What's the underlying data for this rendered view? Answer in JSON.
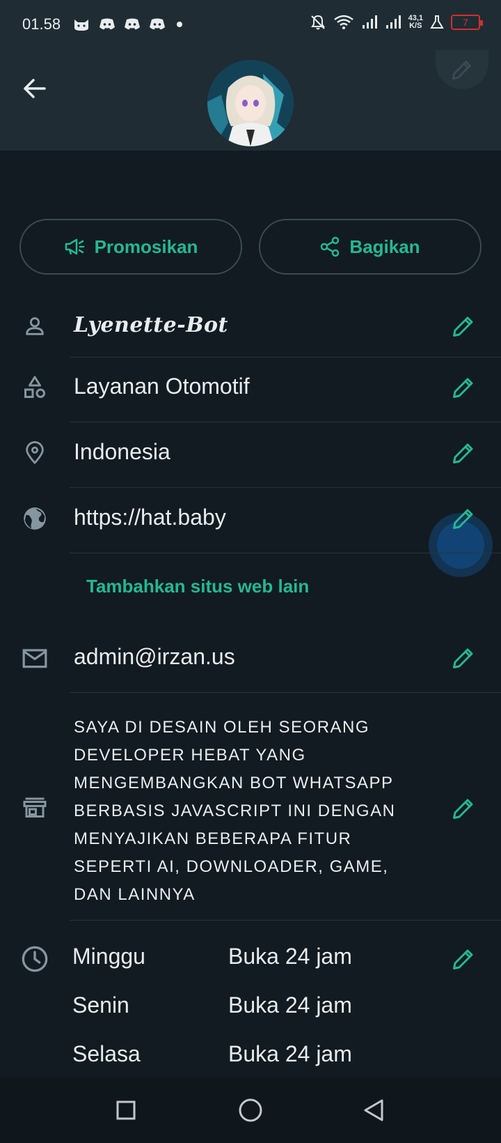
{
  "status_bar": {
    "time": "01.58",
    "net_speed_value": "43,1",
    "net_speed_unit": "K/S",
    "battery_level": "7",
    "app_icons": [
      "cat-app-icon",
      "discord-icon",
      "discord-icon",
      "discord-icon"
    ],
    "system_icons": [
      "bell-off-icon",
      "wifi-icon",
      "signal-icon",
      "signal-icon",
      "flask-icon"
    ]
  },
  "header": {
    "back_icon": "arrow-left-icon",
    "edit_photo_icon": "pencil-icon"
  },
  "actions": {
    "promote_label": "Promosikan",
    "share_label": "Bagikan"
  },
  "profile": {
    "name": "Lyenette-Bot",
    "category": "Layanan Otomotif",
    "location": "Indonesia",
    "website": "https://hat.baby",
    "add_website_label": "Tambahkan situs web lain",
    "email": "admin@irzan.us",
    "description": "SAYA DI DESAIN OLEH SEORANG DEVELOPER HEBAT YANG MENGEMBANGKAN BOT WHATSAPP BERBASIS JAVASCRIPT INI DENGAN MENYAJIKAN BEBERAPA FITUR SEPERTI AI, DOWNLOADER, GAME, DAN LAINNYA"
  },
  "hours": [
    {
      "day": "Minggu",
      "value": "Buka 24 jam"
    },
    {
      "day": "Senin",
      "value": "Buka 24 jam"
    },
    {
      "day": "Selasa",
      "value": "Buka 24 jam"
    }
  ],
  "colors": {
    "accent": "#25b892",
    "background": "#121b22",
    "header": "#1f2c33",
    "icon_gray": "#8696a0"
  }
}
